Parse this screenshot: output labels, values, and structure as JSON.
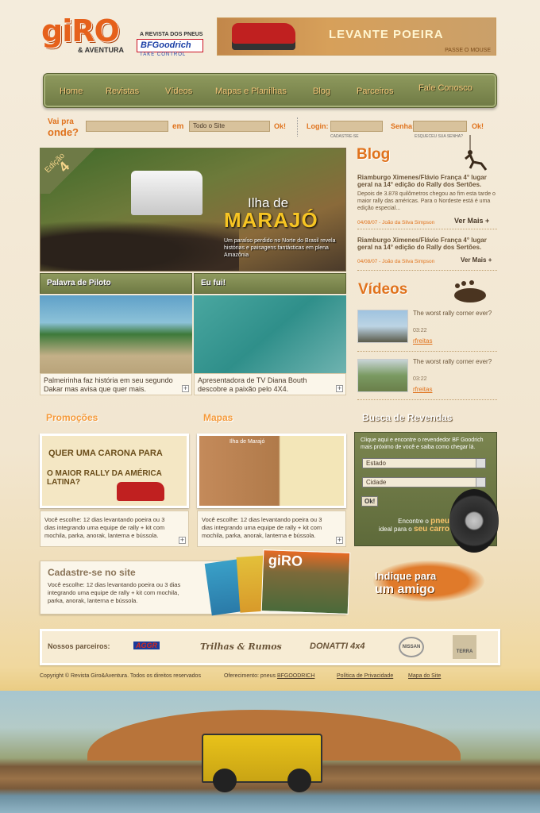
{
  "header": {
    "logo_main": "giRO",
    "logo_sub": "& AVENTURA",
    "tagline": "A REVISTA DOS PNEUS",
    "brand": "BFGoodrich",
    "brand_sub": "TAKE CONTROL",
    "banner_text": "LEVANTE POEIRA",
    "banner_hint": "PASSE O MOUSE"
  },
  "nav": [
    "Home",
    "Revistas",
    "Vídeos",
    "Mapas e Planilhas",
    "Blog",
    "Parceiros",
    "Fale Conosco"
  ],
  "search": {
    "vai": "Vai pra",
    "onde": "onde?",
    "em": "em",
    "scope": "Todo o Site",
    "ok": "Ok!",
    "login": "Login:",
    "senha": "Senha:",
    "cadastre": "CADASTRE-SE",
    "esqueceu": "ESQUECEU SUA SENHA?",
    "ok2": "Ok!"
  },
  "feature": {
    "edicao": "Edição",
    "num": "4",
    "title1": "Ilha de",
    "title2": "MARAJÓ",
    "desc": "Um paraíso perdido no Norte do Brasil revela histórias e paisagens fantásticas em plena Amazônia"
  },
  "sections": {
    "piloto": "Palavra de Piloto",
    "eufui": "Eu fui!",
    "piloto_cap": "Palmeirinha faz história em seu segundo Dakar mas avisa que quer mais.",
    "eufui_cap": "Apresentadora de TV Diana Bouth descobre a paixão pelo 4X4."
  },
  "blog": {
    "title": "Blog",
    "items": [
      {
        "title": "Riamburgo Ximenes/Flávio França 4° lugar geral na 14° edição do Rally dos Sertões.",
        "desc": "Depois de 3.878 quilômetros chegou ao fim esta tarde o maior rally das américas. Para o Nordeste está é uma edição especial...",
        "meta": "04/08/07 - João da Silva Simpson",
        "more": "Ver Mais +"
      },
      {
        "title": "Riamburgo Ximenes/Flávio França 4° lugar geral na 14° edição do Rally dos Sertões.",
        "meta": "04/08/07 - João da Silva Simpson",
        "more": "Ver Mais +"
      }
    ]
  },
  "videos": {
    "title": "Vídeos",
    "items": [
      {
        "title": "The worst rally corner ever?",
        "dur": "03:22",
        "user": "rfreitas"
      },
      {
        "title": "The worst rally corner ever?",
        "dur": "03:22",
        "user": "rfreitas"
      }
    ]
  },
  "promos": {
    "title": "Promoções",
    "img_l1": "QUER UMA CARONA PARA",
    "img_l2": "O MAIOR RALLY DA AMÉRICA LATINA?",
    "cap": "Você escolhe: 12 dias levantando poeira ou 3 dias integrando uma equipe de rally + kit com mochila, parka, anorak, lanterna e bússola."
  },
  "mapas": {
    "title": "Mapas",
    "map_label": "Ilha de Marajó",
    "cap": "Você escolhe: 12 dias levantando poeira ou 3 dias integrando uma equipe de rally + kit com mochila, parka, anorak, lanterna e bússola."
  },
  "busca": {
    "title": "Busca de Revendas",
    "text": "Clique aqui e encontre o revendedor BF Goodrich mais próximo de você e saiba como chegar lá.",
    "estado": "Estado",
    "cidade": "Cidade",
    "ok": "Ok!",
    "enc1": "Encontre o",
    "enc_b1": "pneu",
    "enc2": "ideal para o",
    "enc_b2": "seu carro"
  },
  "indique": {
    "l1": "Indique para",
    "l2": "um amigo"
  },
  "cadastre": {
    "title": "Cadastre-se no site",
    "text": "Você escolhe: 12 dias levantando poeira ou 3 dias integrando uma equipe de rally + kit com mochila, parka, anorak, lanterna e bússola.",
    "mag": "giRO"
  },
  "parceiros": {
    "label": "Nossos parceiros:",
    "logos": [
      "AGGR",
      "Trilhas & Rumos",
      "DONATTI 4x4",
      "NISSAN",
      "TERRA"
    ]
  },
  "footer": {
    "copy": "Copyright © Revista Giro&Aventura. Todos os direitos reservados",
    "ofer": "Oferecimento: pneus ",
    "ofer_link": "BFGOODRICH",
    "priv": "Política de Privacidade",
    "mapa": "Mapa do Site"
  },
  "colors": {
    "orange": "#e0721c",
    "olive": "#6f7a44",
    "beige": "#f4ecdc"
  }
}
